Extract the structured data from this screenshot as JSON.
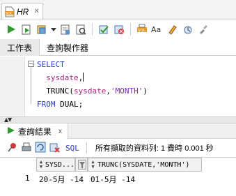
{
  "document_tab": {
    "title": "HR",
    "icon": "sql-file-icon"
  },
  "toolbar": {
    "buttons": [
      "run-statement-icon",
      "run-script-icon",
      "autotrace-icon",
      "dropdown-arrow-icon",
      "explain-plan-icon",
      "sql-tuning-icon",
      "commit-icon",
      "rollback-icon",
      "sql-history-icon",
      "uppercase-icon",
      "clear-icon",
      "tune-icon",
      "format-icon"
    ]
  },
  "sub_tabs": [
    {
      "label": "工作表",
      "active": true
    },
    {
      "label": "查詢製作器",
      "active": false
    }
  ],
  "editor": {
    "lines": [
      {
        "kw": "SELECT"
      },
      {
        "sysdate": "sysdate",
        "punct": ","
      },
      {
        "fn": "TRUNC(",
        "sysdate": "sysdate",
        "mid": ",",
        "lit": "'MONTH'",
        "end": ")"
      },
      {
        "kw": "FROM",
        "rest": " DUAL;"
      }
    ]
  },
  "results": {
    "tab_label": "查詢結果",
    "tab_close": "x",
    "sql_link": "SQL",
    "status": "所有擷取的資料列: 1 費時 0.001 秒",
    "columns": [
      "SYSD...",
      "TRUNC(SYSDATE,'MONTH')"
    ],
    "rows": [
      {
        "num": "1",
        "cells": [
          "20-5月 -14",
          "01-5月 -14"
        ]
      }
    ]
  },
  "colors": {
    "keyword": "#2a3fc8",
    "literal": "#7a2bb3",
    "sysdate": "#b1227a"
  }
}
